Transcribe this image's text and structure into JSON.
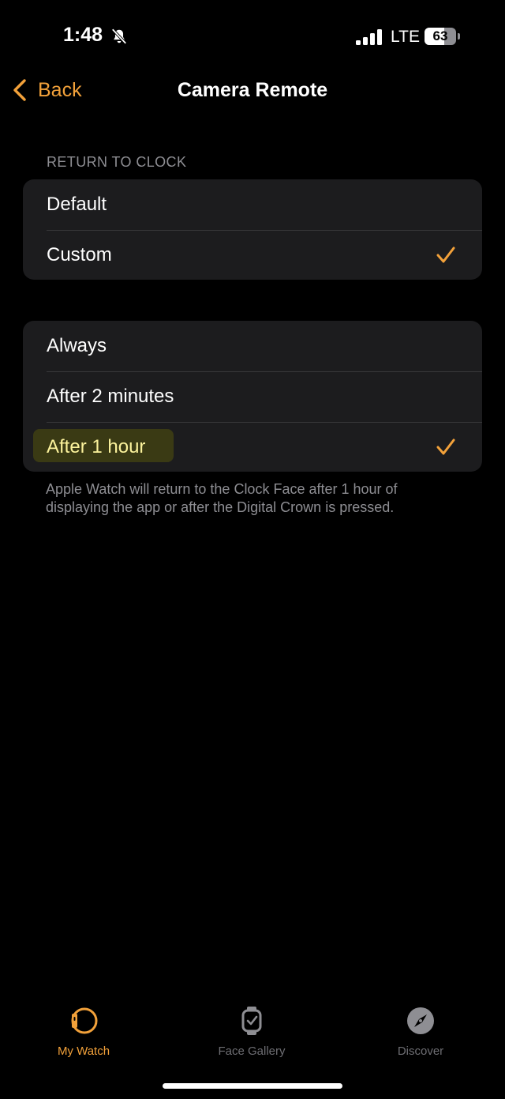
{
  "status_bar": {
    "time": "1:48",
    "network": "LTE",
    "battery_level": "63",
    "battery_fraction": 0.63,
    "icons": [
      "bell-slash-icon",
      "signal-icon",
      "battery-icon"
    ]
  },
  "nav": {
    "back_label": "Back",
    "title": "Camera Remote"
  },
  "return_to_clock": {
    "header": "RETURN TO CLOCK",
    "options": [
      {
        "label": "Default",
        "selected": false
      },
      {
        "label": "Custom",
        "selected": true
      }
    ]
  },
  "timeout": {
    "options": [
      {
        "label": "Always",
        "selected": false
      },
      {
        "label": "After 2 minutes",
        "selected": false
      },
      {
        "label": "After 1 hour",
        "selected": true,
        "highlighted": true
      }
    ],
    "footer": "Apple Watch will return to the Clock Face after 1 hour of displaying the app or after the Digital Crown is pressed."
  },
  "tab_bar": {
    "tabs": [
      {
        "label": "My Watch",
        "icon": "watch-icon",
        "active": true
      },
      {
        "label": "Face Gallery",
        "icon": "face-gallery-icon",
        "active": false
      },
      {
        "label": "Discover",
        "icon": "compass-icon",
        "active": false
      }
    ]
  },
  "colors": {
    "accent": "#f2a13a",
    "background": "#000000",
    "group_background": "#1c1c1e",
    "secondary_text": "#8e8e93",
    "highlight_text": "#fbf29c"
  }
}
